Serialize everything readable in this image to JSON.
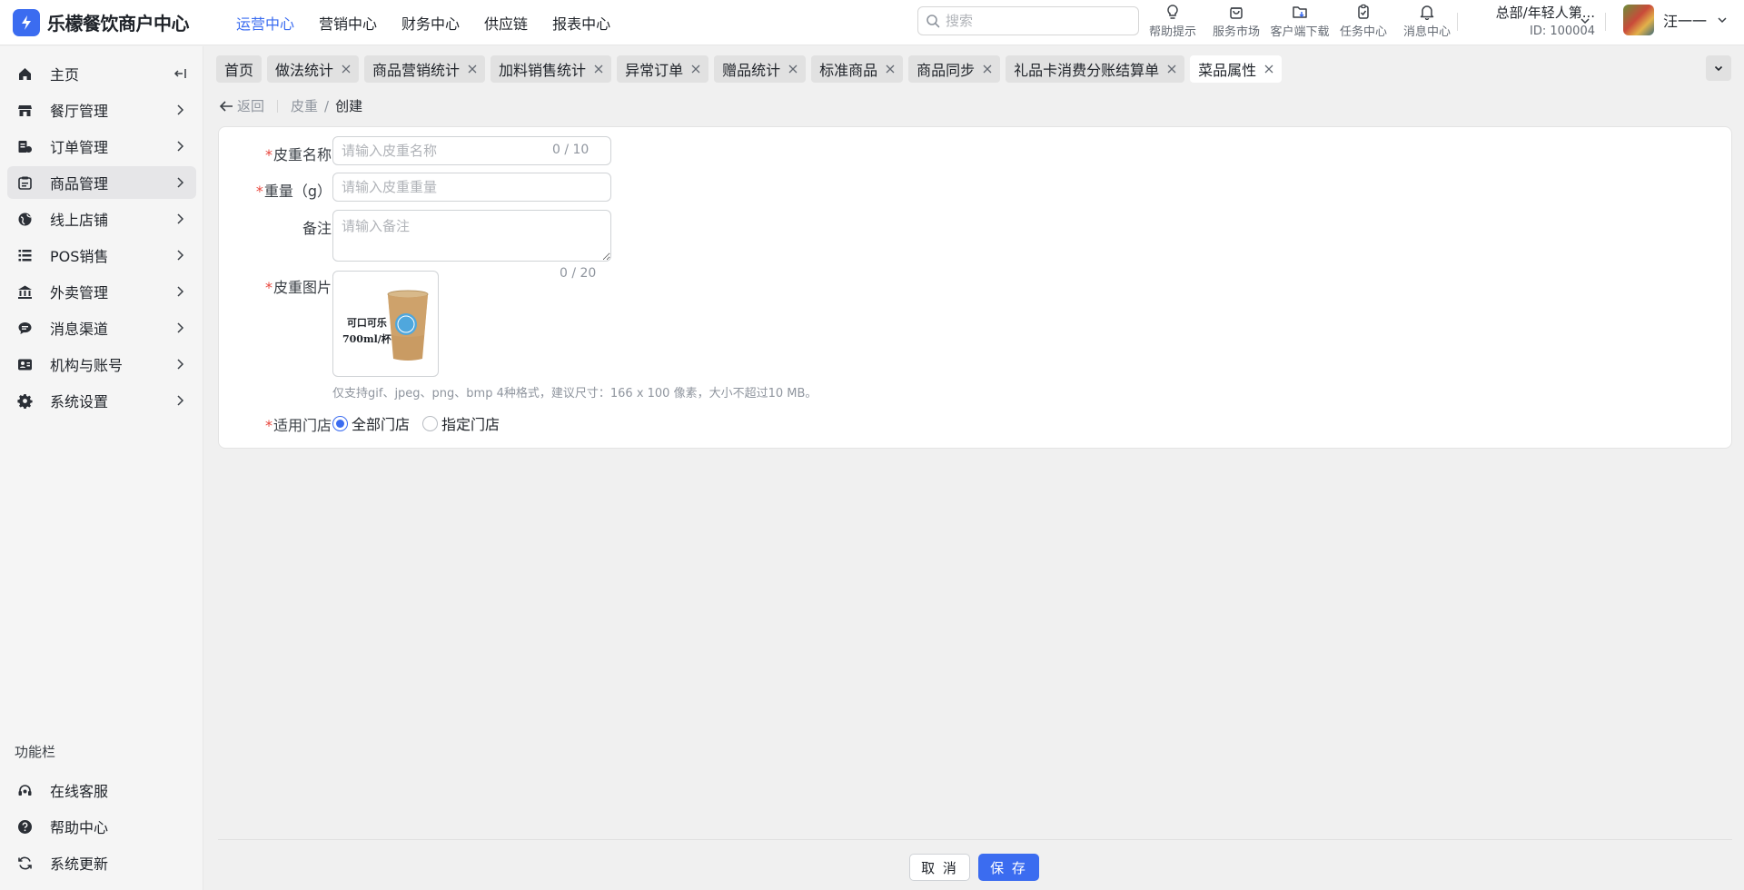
{
  "app": {
    "name": "乐檬餐饮商户中心"
  },
  "topnav": [
    {
      "label": "运营中心",
      "active": true
    },
    {
      "label": "营销中心",
      "active": false
    },
    {
      "label": "财务中心",
      "active": false
    },
    {
      "label": "供应链",
      "active": false
    },
    {
      "label": "报表中心",
      "active": false
    }
  ],
  "search": {
    "placeholder": "搜索"
  },
  "tools": [
    {
      "label": "帮助提示",
      "icon": "lightbulb-icon"
    },
    {
      "label": "服务市场",
      "icon": "shopping-bag-icon"
    },
    {
      "label": "客户端下载",
      "icon": "folder-download-icon"
    },
    {
      "label": "任务中心",
      "icon": "clipboard-check-icon"
    },
    {
      "label": "消息中心",
      "icon": "bell-icon"
    }
  ],
  "org": {
    "name": "总部/年轻人第...",
    "id": "ID: 100004"
  },
  "user": {
    "name": "汪一一"
  },
  "sidebar": {
    "items": [
      {
        "label": "主页",
        "icon": "home-icon",
        "active": false
      },
      {
        "label": "餐厅管理",
        "icon": "store-icon",
        "active": false
      },
      {
        "label": "订单管理",
        "icon": "order-list-icon",
        "active": false
      },
      {
        "label": "商品管理",
        "icon": "product-icon",
        "active": true
      },
      {
        "label": "线上店铺",
        "icon": "globe-icon",
        "active": false
      },
      {
        "label": "POS销售",
        "icon": "pos-terminal-icon",
        "active": false
      },
      {
        "label": "外卖管理",
        "icon": "building-icon",
        "active": false
      },
      {
        "label": "消息渠道",
        "icon": "chat-bubble-icon",
        "active": false
      },
      {
        "label": "机构与账号",
        "icon": "id-card-icon",
        "active": false
      },
      {
        "label": "系统设置",
        "icon": "gear-icon",
        "active": false
      }
    ],
    "func_title": "功能栏",
    "func_items": [
      {
        "label": "在线客服",
        "icon": "headset-icon"
      },
      {
        "label": "帮助中心",
        "icon": "help-circle-icon"
      },
      {
        "label": "系统更新",
        "icon": "refresh-icon"
      }
    ]
  },
  "tabs": [
    {
      "label": "首页",
      "closable": false,
      "active": false
    },
    {
      "label": "做法统计",
      "closable": true,
      "active": false
    },
    {
      "label": "商品营销统计",
      "closable": true,
      "active": false
    },
    {
      "label": "加料销售统计",
      "closable": true,
      "active": false
    },
    {
      "label": "异常订单",
      "closable": true,
      "active": false
    },
    {
      "label": "赠品统计",
      "closable": true,
      "active": false
    },
    {
      "label": "标准商品",
      "closable": true,
      "active": false
    },
    {
      "label": "商品同步",
      "closable": true,
      "active": false
    },
    {
      "label": "礼品卡消费分账结算单",
      "closable": true,
      "active": false
    },
    {
      "label": "菜品属性",
      "closable": true,
      "active": true
    }
  ],
  "breadcrumb": {
    "back": "返回",
    "parent": "皮重",
    "separator": "/",
    "current": "创建"
  },
  "form": {
    "name": {
      "required": "*",
      "label": "皮重名称",
      "placeholder": "请输入皮重名称",
      "value": "",
      "count": "0 / 10"
    },
    "weight": {
      "required": "*",
      "label": "重量（g）",
      "placeholder": "请输入皮重重量",
      "value": ""
    },
    "remark": {
      "label": "备注",
      "placeholder": "请输入备注",
      "value": "",
      "count": "0 / 20"
    },
    "image": {
      "required": "*",
      "label": "皮重图片",
      "image_text_line1": "可口可乐",
      "image_text_line2": "700ml/杯",
      "hint": "仅支持gif、jpeg、png、bmp 4种格式，建议尺寸：166 x 100 像素，大小不超过10 MB。"
    },
    "store": {
      "required": "*",
      "label": "适用门店",
      "options": [
        {
          "label": "全部门店",
          "checked": true
        },
        {
          "label": "指定门店",
          "checked": false
        }
      ]
    }
  },
  "footer": {
    "cancel_label": "取 消",
    "save_label": "保 存"
  },
  "colors": {
    "accent": "#3b6cf0",
    "required": "#e8453c",
    "background": "#f0f0f0"
  }
}
